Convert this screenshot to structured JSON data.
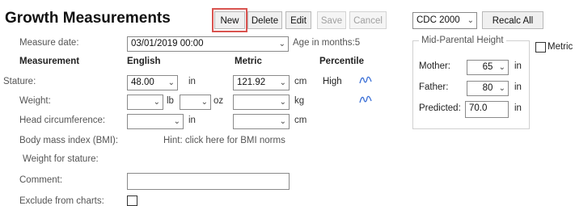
{
  "header": {
    "title": "Growth Measurements",
    "buttons": {
      "new": "New",
      "delete": "Delete",
      "edit": "Edit",
      "save": "Save",
      "cancel": "Cancel",
      "recalc": "Recalc All"
    },
    "chart_standard": "CDC 2000"
  },
  "form": {
    "measure_date_label": "Measure date:",
    "measure_date_value": "03/01/2019 00:00",
    "age_months": "Age in months:5",
    "col_measurement": "Measurement",
    "col_english": "English",
    "col_metric": "Metric",
    "col_percentile": "Percentile",
    "stature_label": "Stature:",
    "stature_english": "48.00",
    "stature_english_unit": "in",
    "stature_metric": "121.92",
    "stature_metric_unit": "cm",
    "stature_percentile": "High",
    "weight_label": "Weight:",
    "weight_lb_unit": "lb",
    "weight_oz_unit": "oz",
    "weight_metric_unit": "kg",
    "head_label": "Head circumference:",
    "head_english_unit": "in",
    "head_metric_unit": "cm",
    "bmi_label": "Body mass index (BMI):",
    "bmi_hint": "Hint: click here for BMI norms",
    "weight_for_stature_label": "Weight for stature:",
    "comment_label": "Comment:",
    "comment_value": "",
    "exclude_label": "Exclude from charts:"
  },
  "mid_parental": {
    "legend": "Mid-Parental Height",
    "mother_label": "Mother:",
    "mother_value": "65",
    "mother_unit": "in",
    "father_label": "Father:",
    "father_value": "80",
    "father_unit": "in",
    "predicted_label": "Predicted:",
    "predicted_value": "70.0",
    "predicted_unit": "in"
  },
  "metric_checkbox_label": "Metric",
  "icons": {
    "chart_icon": "~"
  }
}
